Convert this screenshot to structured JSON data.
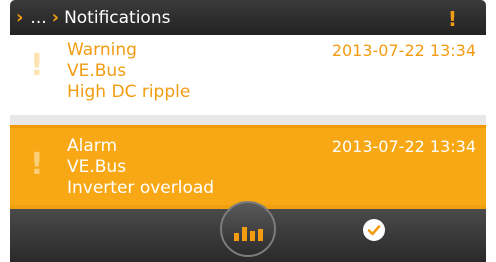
{
  "header": {
    "ellipsis": "...",
    "title": "Notifications",
    "alert_glyph": "!"
  },
  "notifications": [
    {
      "type": "Warning",
      "source": "VE.Bus",
      "message": "High DC ripple",
      "date": "2013-07-22 13:34",
      "icon": "exclamation-icon",
      "color": "#f39c12"
    },
    {
      "type": "Alarm",
      "source": "VE.Bus",
      "message": "Inverter overload",
      "date": "2013-07-22 13:34",
      "icon": "exclamation-icon",
      "color": "#f7a814"
    }
  ],
  "toolbar": {
    "menu_icon": "bar-chart-icon",
    "ack_icon": "checkmark-icon"
  },
  "colors": {
    "accent": "#f39c12",
    "titlebar": "#2a2a2a",
    "alarm_background": "#f7a814"
  }
}
